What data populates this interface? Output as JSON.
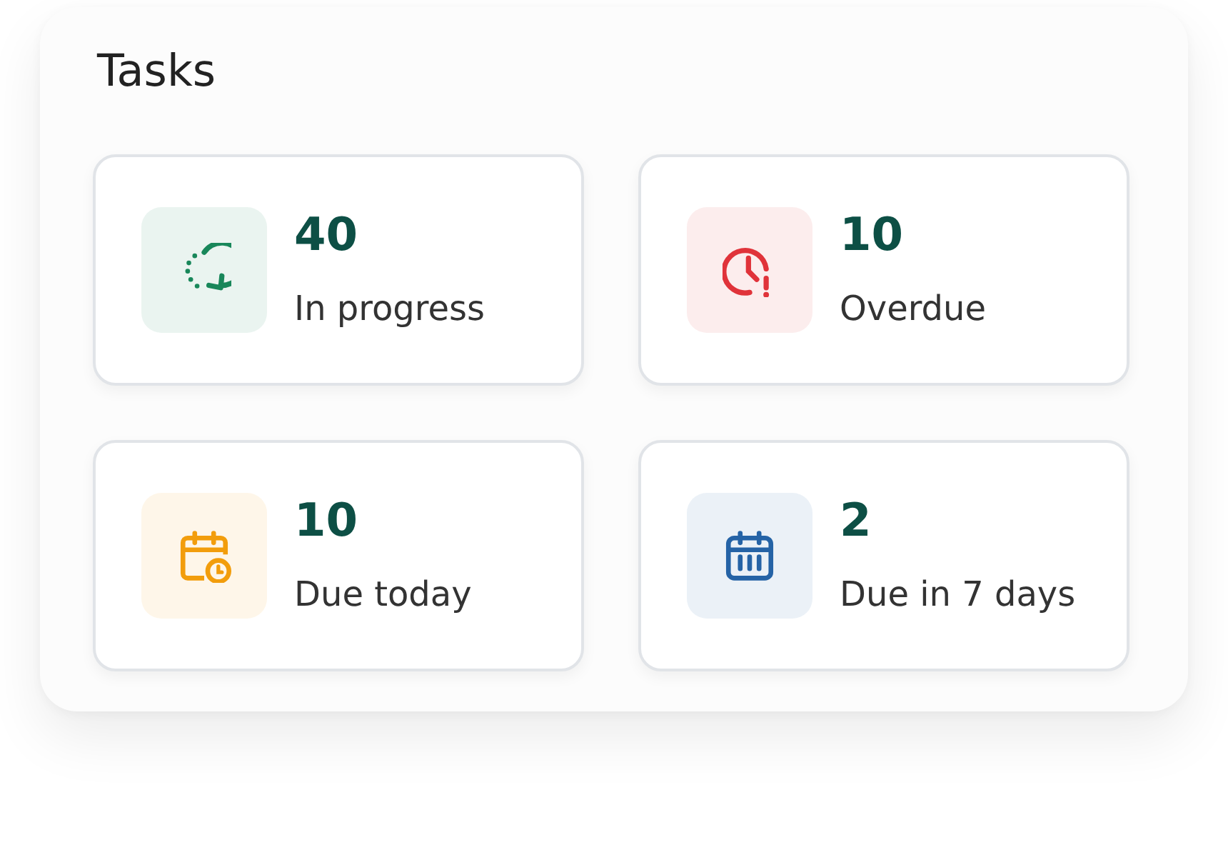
{
  "title": "Tasks",
  "cards": [
    {
      "kind": "progress",
      "color": "#18875a",
      "count": "40",
      "label": "In progress"
    },
    {
      "kind": "overdue",
      "color": "#e0333a",
      "count": "10",
      "label": "Overdue"
    },
    {
      "kind": "due-today",
      "color": "#f29d0c",
      "count": "10",
      "label": "Due today"
    },
    {
      "kind": "due-week",
      "color": "#2563a6",
      "count": "2",
      "label": "Due in 7 days"
    }
  ]
}
